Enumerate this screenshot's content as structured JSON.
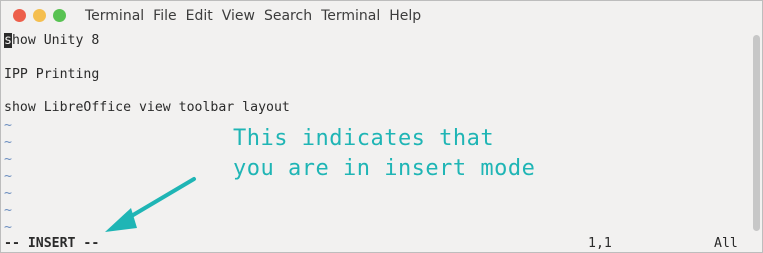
{
  "window": {
    "buttons": [
      {
        "name": "close",
        "color": "#ed5f4b"
      },
      {
        "name": "minimize",
        "color": "#f5bf4f"
      },
      {
        "name": "maximize",
        "color": "#58c252"
      }
    ]
  },
  "menu": {
    "items": [
      "Terminal",
      "File",
      "Edit",
      "View",
      "Search",
      "Terminal",
      "Help"
    ]
  },
  "editor": {
    "cursor_char": "s",
    "lines": [
      {
        "rest": "how Unity 8"
      },
      {
        "text": ""
      },
      {
        "text": "IPP Printing"
      },
      {
        "text": ""
      },
      {
        "text": "show LibreOffice view toolbar layout"
      }
    ],
    "tilde": "~",
    "tilde_color": "#6c8ebf"
  },
  "status": {
    "mode": "-- INSERT --",
    "position": "1,1",
    "scroll": "All"
  },
  "annotation": {
    "line1": "This indicates that",
    "line2": "you are in insert mode",
    "color": "#1fb5b5"
  }
}
